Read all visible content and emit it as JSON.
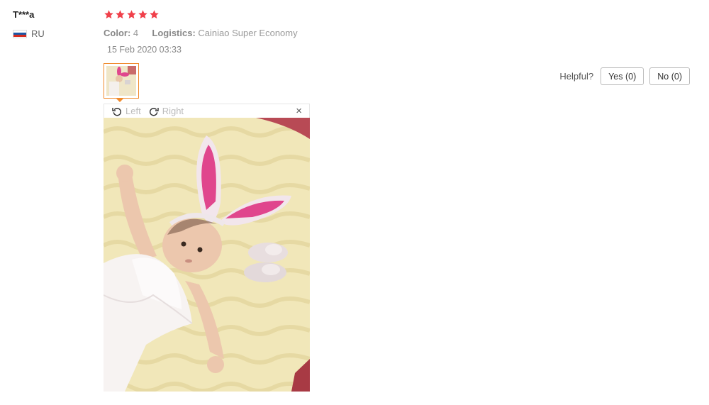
{
  "user": {
    "name": "T***a",
    "country": "RU"
  },
  "rating": {
    "stars": 5,
    "color": "#f0404a"
  },
  "meta": {
    "color_label": "Color:",
    "color_value": "4",
    "logistics_label": "Logistics:",
    "logistics_value": "Cainiao Super Economy"
  },
  "date": "15 Feb 2020 03:33",
  "helpful": {
    "label": "Helpful?",
    "yes": "Yes (0)",
    "no": "No (0)"
  },
  "viewer": {
    "rotate_left": "Left",
    "rotate_right": "Right",
    "close": "×"
  },
  "icons": {
    "flag": "russia-flag-icon",
    "star": "star-icon",
    "rotate_left": "rotate-left-icon",
    "rotate_right": "rotate-right-icon",
    "close": "close-icon"
  }
}
